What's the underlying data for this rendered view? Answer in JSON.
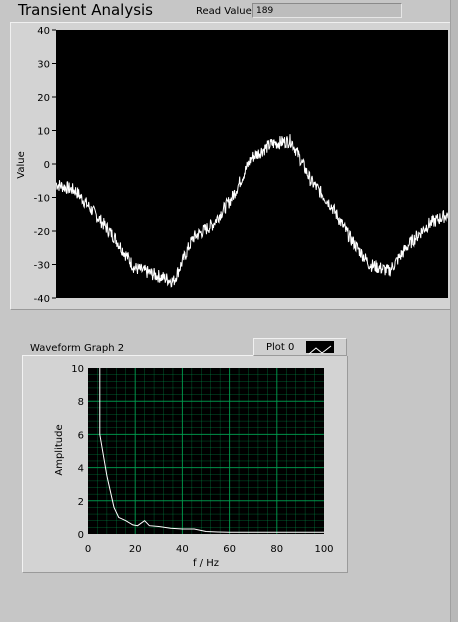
{
  "window": {
    "title": "Transient Analysis"
  },
  "read_value": {
    "label": "Read Value",
    "value": "189"
  },
  "graph1": {
    "ylabel": "Value",
    "yticks": [
      "40",
      "30",
      "20",
      "10",
      "0",
      "-10",
      "-20",
      "-30",
      "-40"
    ],
    "bg": "#000000",
    "line_color": "#ffffff"
  },
  "graph2": {
    "title": "Waveform Graph 2",
    "legend_label": "Plot 0",
    "xlabel": "f / Hz",
    "ylabel": "Amplitude",
    "yticks": [
      "10",
      "8",
      "6",
      "4",
      "2",
      "0"
    ],
    "xticks": [
      "0",
      "20",
      "40",
      "60",
      "80",
      "100"
    ],
    "grid_color": "#00a050",
    "line_color": "#ffffff"
  },
  "chart_data": [
    {
      "type": "line",
      "title": "",
      "ylabel": "Value",
      "ylim": [
        -40,
        40
      ],
      "x": [
        0,
        0.05,
        0.1,
        0.15,
        0.2,
        0.25,
        0.3,
        0.35,
        0.4,
        0.45,
        0.5,
        0.55,
        0.6,
        0.65,
        0.7,
        0.75,
        0.8,
        0.85,
        0.9,
        0.95,
        1.0
      ],
      "y": [
        -6,
        -8,
        -15,
        -22,
        -31,
        -33,
        -35,
        -22,
        -18,
        -10,
        2,
        6,
        7,
        -5,
        -12,
        -22,
        -30,
        -32,
        -24,
        -18,
        -15
      ]
    },
    {
      "type": "line",
      "title": "Waveform Graph 2",
      "xlabel": "f / Hz",
      "ylabel": "Amplitude",
      "xlim": [
        0,
        100
      ],
      "ylim": [
        0,
        10
      ],
      "x": [
        5,
        8,
        11,
        13,
        16,
        19,
        21,
        24,
        26,
        30,
        35,
        40,
        45,
        50,
        55,
        60,
        70,
        80,
        90,
        100
      ],
      "y": [
        6,
        3.5,
        1.6,
        1.0,
        0.8,
        0.55,
        0.5,
        0.8,
        0.5,
        0.45,
        0.35,
        0.3,
        0.3,
        0.15,
        0.12,
        0.1,
        0.1,
        0.1,
        0.1,
        0.1
      ]
    }
  ]
}
